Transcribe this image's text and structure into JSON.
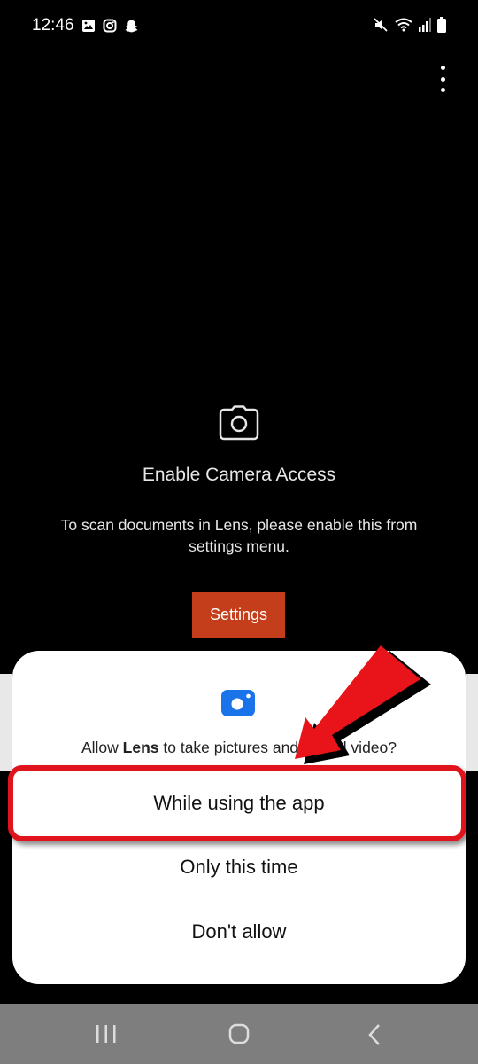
{
  "status_bar": {
    "time": "12:46",
    "left_icons": [
      "gallery-icon",
      "instagram-icon",
      "snapchat-icon"
    ],
    "right_icons": [
      "mute-icon",
      "wifi-icon",
      "signal-icon",
      "battery-icon"
    ]
  },
  "camera_screen": {
    "title": "Enable Camera Access",
    "description": "To scan documents in Lens, please enable this from settings menu.",
    "settings_label": "Settings"
  },
  "permission_dialog": {
    "question_prefix": "Allow ",
    "app_name": "Lens",
    "question_suffix": " to take pictures and record video?",
    "options": [
      {
        "label": "While using the app"
      },
      {
        "label": "Only this time"
      },
      {
        "label": "Don't allow"
      }
    ]
  },
  "colors": {
    "accent": "#c43e1c",
    "dialog_icon": "#1a73e8",
    "highlight": "#e0141c"
  }
}
